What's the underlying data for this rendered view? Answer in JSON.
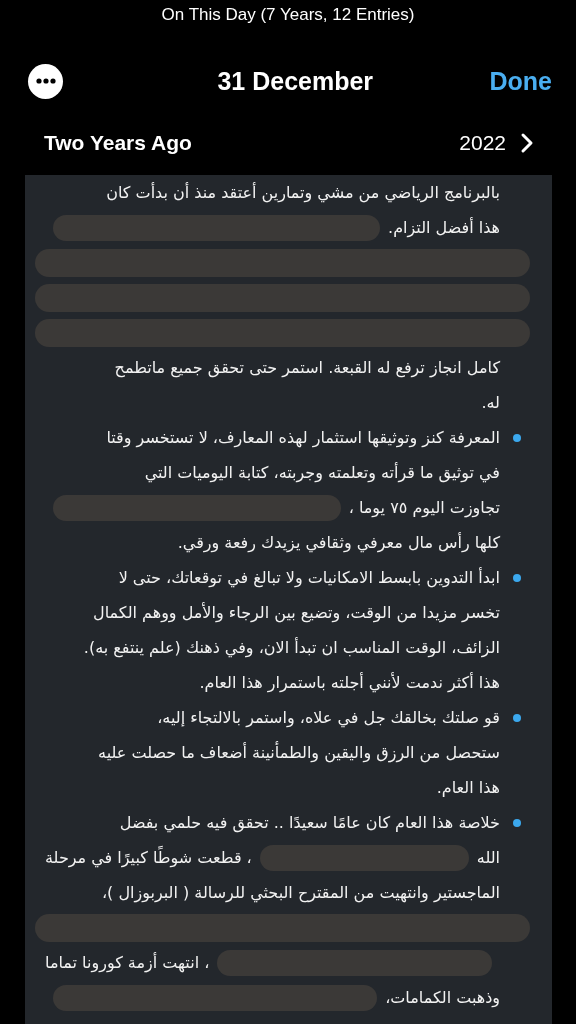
{
  "status_title": "On This Day (7 Years, 12 Entries)",
  "nav": {
    "title": "31 December",
    "done": "Done"
  },
  "section": {
    "heading": "Two Years Ago",
    "year": "2022"
  },
  "paragraphs": [
    {
      "bullet": false,
      "lines": [
        {
          "kind": "text",
          "segments": [
            {
              "kind": "text",
              "text": "بالبرنامج الرياضي من مشي وتمارين أعتقد منذ أن بدأت كان"
            }
          ]
        },
        {
          "kind": "text",
          "segments": [
            {
              "kind": "text",
              "text": "هذا أفضل التزام."
            },
            {
              "kind": "redaction"
            }
          ]
        },
        {
          "kind": "redacted"
        },
        {
          "kind": "redacted"
        },
        {
          "kind": "redacted"
        },
        {
          "kind": "text",
          "segments": [
            {
              "kind": "text",
              "text": "كامل انجاز ترفع له القبعة. استمر حتى تحقق جميع ماتطمح"
            }
          ]
        },
        {
          "kind": "text",
          "segments": [
            {
              "kind": "text",
              "text": "له."
            }
          ]
        }
      ]
    },
    {
      "bullet": true,
      "lines": [
        {
          "kind": "text",
          "segments": [
            {
              "kind": "text",
              "text": "المعرفة كنز وتوثيقها استثمار لهذه المعارف، لا تستخسر وقتا"
            }
          ]
        },
        {
          "kind": "text",
          "segments": [
            {
              "kind": "text",
              "text": "في توثيق ما قرأته وتعلمته وجربته، كتابة اليوميات التي"
            }
          ]
        },
        {
          "kind": "text",
          "segments": [
            {
              "kind": "text",
              "text": "تجاوزت اليوم ٧٥ يوما ،"
            },
            {
              "kind": "redaction"
            }
          ]
        },
        {
          "kind": "text",
          "segments": [
            {
              "kind": "text",
              "text": "كلها رأس مال معرفي وثقافي يزيدك رفعة ورقي."
            }
          ]
        }
      ]
    },
    {
      "bullet": true,
      "lines": [
        {
          "kind": "text",
          "segments": [
            {
              "kind": "text",
              "text": "ابدأ التدوين بابسط الامكانيات ولا تبالغ في توقعاتك، حتى لا"
            }
          ]
        },
        {
          "kind": "text",
          "segments": [
            {
              "kind": "text",
              "text": "تخسر مزيدا من الوقت، وتضيع بين الرجاء والأمل ووهم الكمال"
            }
          ]
        },
        {
          "kind": "text",
          "segments": [
            {
              "kind": "text",
              "text": "الزائف، الوقت المناسب ان تبدأ الان، وفي ذهنك (علم ينتفع به)."
            }
          ]
        },
        {
          "kind": "text",
          "segments": [
            {
              "kind": "text",
              "text": "هذا أكثر ندمت لأنني أجلته باستمرار هذا العام."
            }
          ]
        }
      ]
    },
    {
      "bullet": true,
      "lines": [
        {
          "kind": "text",
          "segments": [
            {
              "kind": "text",
              "text": "قو صلتك بخالقك جل في علاه، واستمر بالالتجاء إليه،"
            }
          ]
        },
        {
          "kind": "text",
          "segments": [
            {
              "kind": "text",
              "text": "ستحصل من الرزق واليقين والطمأنينة أضعاف ما حصلت عليه"
            }
          ]
        },
        {
          "kind": "text",
          "segments": [
            {
              "kind": "text",
              "text": "هذا العام."
            }
          ]
        }
      ]
    },
    {
      "bullet": true,
      "lines": [
        {
          "kind": "text",
          "segments": [
            {
              "kind": "text",
              "text": "خلاصة هذا العام كان عامًا سعيدًا .. تحقق فيه حلمي بفضل"
            }
          ]
        },
        {
          "kind": "text",
          "segments": [
            {
              "kind": "text",
              "text": "الله"
            },
            {
              "kind": "redaction"
            },
            {
              "kind": "text",
              "text": "، قطعت شوطًا كبيرًا في مرحلة"
            }
          ]
        },
        {
          "kind": "text",
          "segments": [
            {
              "kind": "text",
              "text": "الماجستير وانتهيت من المقترح البحثي للرسالة ( البربوزال )،"
            }
          ]
        },
        {
          "kind": "redacted"
        },
        {
          "kind": "text",
          "segments": [
            {
              "kind": "redaction"
            },
            {
              "kind": "text",
              "text": "، انتهت أزمة كورونا تماما"
            }
          ]
        },
        {
          "kind": "text",
          "segments": [
            {
              "kind": "text",
              "text": "وذهبت الكمامات،"
            },
            {
              "kind": "redaction"
            }
          ]
        }
      ]
    }
  ]
}
